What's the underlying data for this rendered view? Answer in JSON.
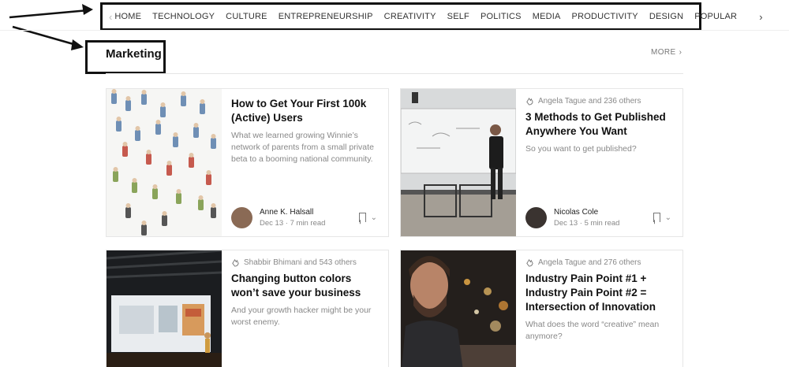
{
  "nav": {
    "prev_icon": "chevron-left-icon",
    "next_icon": "chevron-right-icon",
    "items": [
      "HOME",
      "TECHNOLOGY",
      "CULTURE",
      "ENTREPRENEURSHIP",
      "CREATIVITY",
      "SELF",
      "POLITICS",
      "MEDIA",
      "PRODUCTIVITY",
      "DESIGN",
      "POPULAR"
    ]
  },
  "section": {
    "title": "Marketing",
    "more_label": "MORE",
    "more_icon": "chevron-right-icon"
  },
  "cards": [
    {
      "title": "How to Get Your First 100k (Active) Users",
      "subtitle": "What we learned growing Winnie’s network of parents from a small private beta to a booming national community.",
      "social": "",
      "author": "Anne K. Halsall",
      "date": "Dec 13",
      "read_time": "7 min read"
    },
    {
      "title": "3 Methods to Get Published Anywhere You Want",
      "subtitle": "So you want to get published?",
      "social": "Angela Tague and 236 others",
      "author": "Nicolas Cole",
      "date": "Dec 13",
      "read_time": "5 min read"
    },
    {
      "title": "Changing button colors won’t save your business",
      "subtitle": "And your growth hacker might be your worst enemy.",
      "social": "Shabbir Bhimani and 543 others",
      "author": "",
      "date": "",
      "read_time": ""
    },
    {
      "title": "Industry Pain Point #1 + Industry Pain Point #2 = Intersection of Innovation",
      "subtitle": "What does the word “creative” mean anymore?",
      "social": "Angela Tague and 276 others",
      "author": "",
      "date": "",
      "read_time": ""
    }
  ],
  "colors": {
    "annotation": "#111111",
    "accent_text": "#111111",
    "muted": "#888888"
  }
}
